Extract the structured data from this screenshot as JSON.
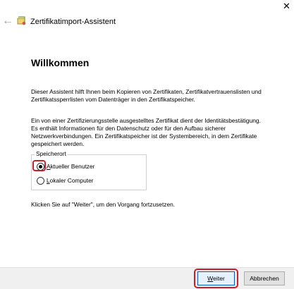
{
  "window": {
    "title": "Zertifikatimport-Assistent",
    "close_glyph": "✕",
    "back_glyph": "←"
  },
  "main": {
    "heading": "Willkommen",
    "intro": "Dieser Assistent hilft Ihnen beim Kopieren von Zertifikaten, Zertifikatvertrauenslisten und\nZertifikatssperrlisten vom Datenträger in den Zertifikatspeicher.",
    "description": "Ein von einer Zertifizierungsstelle ausgestelltes Zertifikat dient der Identitätsbestätigung.\nEs enthält Informationen für den Datenschutz oder für den Aufbau sicherer\nNetzwerkverbindungen. Ein Zertifikatspeicher ist der Systembereich, in dem Zertifikate\ngespeichert werden.",
    "instruction": "Klicken Sie auf \"Weiter\", um den Vorgang fortzusetzen."
  },
  "store": {
    "label": "Speicherort",
    "options": [
      {
        "mnemonic": "A",
        "rest": "ktueller Benutzer",
        "selected": true
      },
      {
        "mnemonic": "L",
        "rest": "okaler Computer",
        "selected": false
      }
    ]
  },
  "buttons": {
    "next_mnemonic": "W",
    "next_rest": "eiter",
    "cancel": "Abbrechen"
  },
  "colors": {
    "highlight": "#cc1f2d",
    "accent": "#0a56b8"
  }
}
